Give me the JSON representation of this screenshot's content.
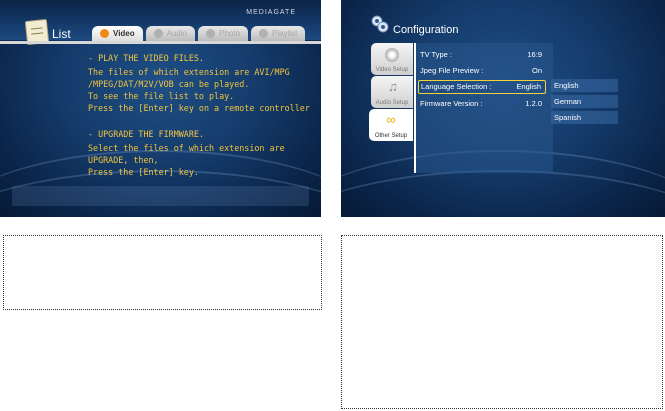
{
  "left_screen": {
    "brand": "MEDIAGATE",
    "title": "List",
    "tabs": [
      {
        "label": "Video",
        "icon": "video-disc-icon",
        "active": true
      },
      {
        "label": "Audio",
        "icon": "music-note-icon",
        "active": false
      },
      {
        "label": "Photo",
        "icon": "camera-icon",
        "active": false
      },
      {
        "label": "Playlist",
        "icon": "playlist-icon",
        "active": false
      }
    ],
    "content": {
      "section1_heading": "- PLAY THE VIDEO FILES.",
      "section1_lines": [
        "The files of which extension are AVI/MPG",
        "/MPEG/DAT/M2V/VOB can be played.",
        "To see the file list to play.",
        "Press the [Enter] key on a remote controller"
      ],
      "section2_heading": "- UPGRADE THE FIRMWARE.",
      "section2_lines": [
        "Select the files of which extension are",
        "UPGRADE, then,",
        "Press the [Enter] key."
      ]
    }
  },
  "right_screen": {
    "title": "Configuration",
    "side_tabs": [
      {
        "label": "Video Setup",
        "icon": "disc-icon",
        "active": false
      },
      {
        "label": "Audio Setup",
        "icon": "music-note-icon",
        "active": false
      },
      {
        "label": "Other Setup",
        "icon": "chain-link-icon",
        "active": true
      }
    ],
    "settings": [
      {
        "label": "TV Type :",
        "value": "16:9"
      },
      {
        "label": "Jpeg File Preview :",
        "value": "On"
      },
      {
        "label": "Language Selection :",
        "value": "English",
        "selected": true
      },
      {
        "label": "Firmware Version :",
        "value": "1.2.0"
      }
    ],
    "language_options": [
      "English",
      "German",
      "Spanish"
    ]
  },
  "colors": {
    "screen_bg": "#143a69",
    "text_yellow": "#f2c43c",
    "selection_border": "#f5d23a",
    "active_tab_icon": "#f08a14"
  }
}
